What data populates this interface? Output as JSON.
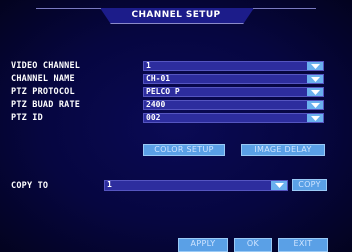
{
  "title": "CHANNEL SETUP",
  "fields": [
    {
      "label": "VIDEO CHANNEL",
      "value": "1"
    },
    {
      "label": "CHANNEL NAME",
      "value": "CH-01"
    },
    {
      "label": "PTZ PROTOCOL",
      "value": "PELCO P"
    },
    {
      "label": "PTZ BUAD RATE",
      "value": "2400"
    },
    {
      "label": "PTZ ID",
      "value": "002"
    }
  ],
  "buttons": {
    "color_setup": "COLOR SETUP",
    "image_delay": "IMAGE DELAY",
    "copy": "COPY",
    "apply": "APPLY",
    "ok": "OK",
    "exit": "EXIT"
  },
  "copy_to": {
    "label": "COPY TO",
    "value": "1"
  },
  "colors": {
    "background": "#060640",
    "field": "#2d2d9e",
    "button": "#5aa0e6",
    "dropdown": "#6ab0ee"
  },
  "icons": {
    "dropdown": "chevron-down-icon"
  }
}
